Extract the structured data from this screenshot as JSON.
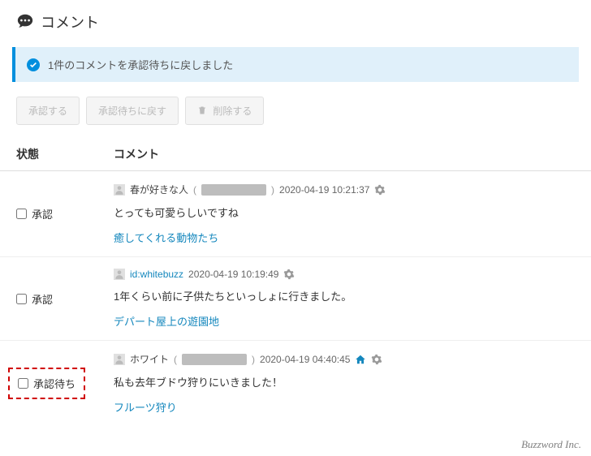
{
  "header": {
    "title": "コメント"
  },
  "alert": {
    "message": "1件のコメントを承認待ちに戻しました"
  },
  "toolbar": {
    "approve": "承認する",
    "revert": "承認待ちに戻す",
    "delete": "削除する"
  },
  "table": {
    "columns": {
      "status": "状態",
      "comment": "コメント"
    }
  },
  "comments": [
    {
      "status": "承認",
      "author": "春が好きな人",
      "authorIsLink": false,
      "showMasked": true,
      "timestamp": "2020-04-19 10:21:37",
      "showHome": false,
      "body": "とっても可愛らしいですね",
      "postLink": "癒してくれる動物たち",
      "highlight": false
    },
    {
      "status": "承認",
      "author": "id:whitebuzz",
      "authorIsLink": true,
      "showMasked": false,
      "timestamp": "2020-04-19 10:19:49",
      "showHome": false,
      "body": "1年くらい前に子供たちといっしょに行きました。",
      "postLink": "デパート屋上の遊園地",
      "highlight": false
    },
    {
      "status": "承認待ち",
      "author": "ホワイト",
      "authorIsLink": false,
      "showMasked": true,
      "timestamp": "2020-04-19 04:40:45",
      "showHome": true,
      "body": "私も去年ブドウ狩りにいきました！",
      "postLink": "フルーツ狩り",
      "highlight": true
    }
  ],
  "footer": {
    "credit": "Buzzword Inc."
  }
}
